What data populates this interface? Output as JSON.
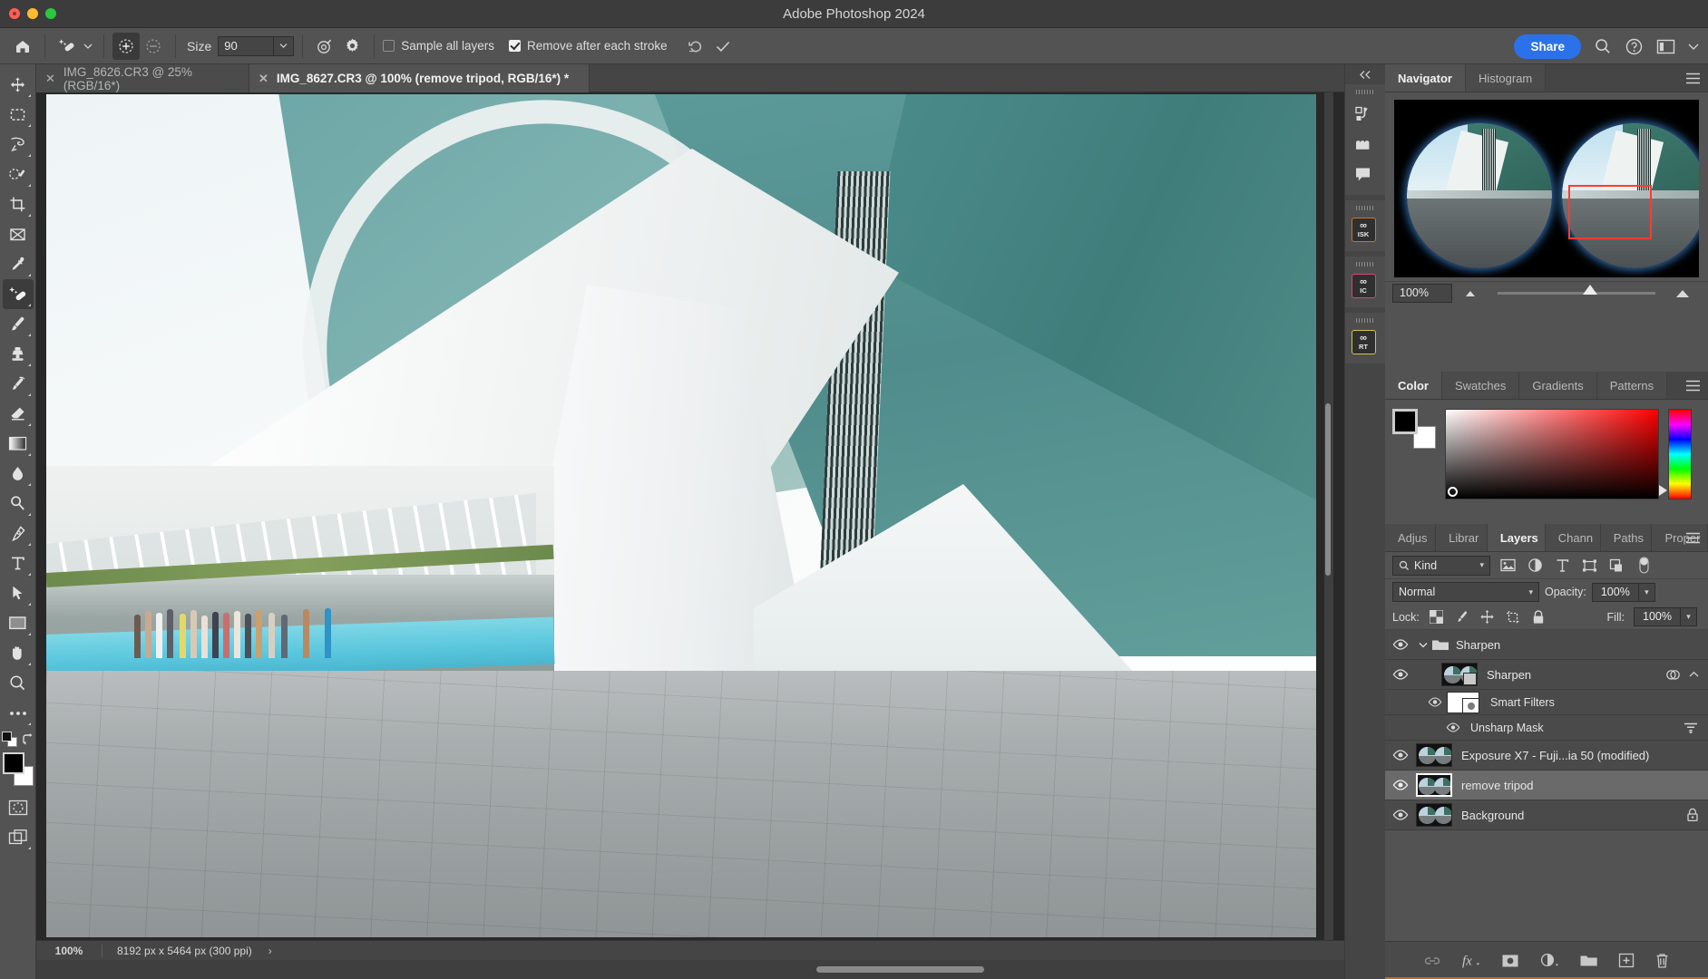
{
  "window": {
    "title": "Adobe Photoshop 2024",
    "traffic_lights": [
      "close",
      "minimize",
      "maximize"
    ]
  },
  "options_bar": {
    "home_icon": "home-icon",
    "tool_icon": "spot-healing-brush-icon",
    "tool_caret": "chevron-down-icon",
    "mode_add_icon": "add-mode-icon",
    "mode_subtract_icon": "subtract-mode-icon",
    "size_label": "Size",
    "size_value": "90",
    "size_caret": "chevron-down-icon",
    "target_icon": "brush-settings-icon",
    "gear_icon": "gear-icon",
    "sample_all_layers": {
      "label": "Sample all layers",
      "checked": false
    },
    "remove_after_each_stroke": {
      "label": "Remove after each stroke",
      "checked": true
    },
    "reset_icon": "reset-undo-icon",
    "commit_icon": "checkmark-icon",
    "share_label": "Share",
    "search_icon": "search-icon",
    "help_icon": "help-circle-icon",
    "workspace_icon": "workspace-panel-icon",
    "workspace_caret": "chevron-down-icon"
  },
  "toolbar": {
    "tools": [
      {
        "name": "move-tool",
        "icon": "move-icon",
        "active": false,
        "has_flyout": true
      },
      {
        "name": "rectangular-marquee-tool",
        "icon": "marquee-icon",
        "active": false,
        "has_flyout": true
      },
      {
        "name": "lasso-tool",
        "icon": "lasso-icon",
        "active": false,
        "has_flyout": true
      },
      {
        "name": "object-selection-tool",
        "icon": "quick-selection-icon",
        "active": false,
        "has_flyout": true
      },
      {
        "name": "crop-tool",
        "icon": "crop-icon",
        "active": false,
        "has_flyout": true
      },
      {
        "name": "frame-tool",
        "icon": "frame-icon",
        "active": false,
        "has_flyout": false
      },
      {
        "name": "eyedropper-tool",
        "icon": "eyedropper-icon",
        "active": false,
        "has_flyout": true
      },
      {
        "name": "spot-healing-brush-tool",
        "icon": "spot-healing-brush-icon",
        "active": true,
        "has_flyout": true
      },
      {
        "name": "brush-tool",
        "icon": "brush-icon",
        "active": false,
        "has_flyout": true
      },
      {
        "name": "clone-stamp-tool",
        "icon": "clone-stamp-icon",
        "active": false,
        "has_flyout": true
      },
      {
        "name": "history-brush-tool",
        "icon": "history-brush-icon",
        "active": false,
        "has_flyout": true
      },
      {
        "name": "eraser-tool",
        "icon": "eraser-icon",
        "active": false,
        "has_flyout": true
      },
      {
        "name": "gradient-tool",
        "icon": "gradient-icon",
        "active": false,
        "has_flyout": true
      },
      {
        "name": "blur-tool",
        "icon": "blur-drop-icon",
        "active": false,
        "has_flyout": true
      },
      {
        "name": "dodge-tool",
        "icon": "dodge-icon",
        "active": false,
        "has_flyout": true
      },
      {
        "name": "pen-tool",
        "icon": "pen-icon",
        "active": false,
        "has_flyout": true
      },
      {
        "name": "type-tool",
        "icon": "type-t-icon",
        "active": false,
        "has_flyout": true
      },
      {
        "name": "path-selection-tool",
        "icon": "path-arrow-icon",
        "active": false,
        "has_flyout": true
      },
      {
        "name": "rectangle-tool",
        "icon": "rectangle-shape-icon",
        "active": false,
        "has_flyout": true
      },
      {
        "name": "hand-tool",
        "icon": "hand-icon",
        "active": false,
        "has_flyout": true
      },
      {
        "name": "zoom-tool",
        "icon": "magnifier-icon",
        "active": false,
        "has_flyout": false
      },
      {
        "name": "edit-toolbar",
        "icon": "ellipsis-icon",
        "active": false,
        "has_flyout": true
      }
    ],
    "default-colors-icon": "default-foreground-background-icon",
    "swap-colors-icon": "swap-colors-icon",
    "foreground_color": "#000000",
    "background_color": "#ffffff",
    "quick_mask_icon": "quick-mask-icon",
    "screen_mode_icon": "screen-mode-icon"
  },
  "document_tabs": [
    {
      "close_icon": "close-x-icon",
      "label": "IMG_8626.CR3 @ 25% (RGB/16*)",
      "active": false
    },
    {
      "close_icon": "close-x-icon",
      "label": "IMG_8627.CR3 @ 100% (remove tripod, RGB/16*) *",
      "active": true
    }
  ],
  "status_bar": {
    "zoom": "100%",
    "dimensions": "8192 px x 5464 px (300 ppi)",
    "expand_icon": "chevron-right-icon"
  },
  "icon_dock": {
    "collapse_icon": "double-chevron-left-icon",
    "groups": [
      {
        "items": [
          {
            "name": "actions-panel-icon",
            "label": ""
          },
          {
            "name": "libraries-panel-icon",
            "label": ""
          },
          {
            "name": "comments-panel-icon",
            "label": ""
          }
        ]
      },
      {
        "items": [
          {
            "name": "plugin-isk-icon",
            "label": "ISK",
            "glyph": "∞",
            "border": "#c07a30"
          }
        ]
      },
      {
        "items": [
          {
            "name": "plugin-ic-icon",
            "label": "IC",
            "glyph": "∞",
            "border": "#d04a7a"
          }
        ]
      },
      {
        "items": [
          {
            "name": "plugin-rt-icon",
            "label": "RT",
            "glyph": "∞",
            "border": "#d4c24a"
          }
        ]
      }
    ]
  },
  "navigator_panel": {
    "tabs": [
      {
        "label": "Navigator",
        "active": true
      },
      {
        "label": "Histogram",
        "active": false
      }
    ],
    "menu_icon": "panel-menu-icon",
    "zoom_value": "100%",
    "zoom_out_icon": "small-mountain-icon",
    "zoom_in_icon": "large-mountain-icon",
    "slider_icon": "zoom-slider-handle",
    "view_box_color": "#ff3b30"
  },
  "color_panel": {
    "tabs": [
      {
        "label": "Color",
        "active": true
      },
      {
        "label": "Swatches",
        "active": false
      },
      {
        "label": "Gradients",
        "active": false
      },
      {
        "label": "Patterns",
        "active": false
      }
    ],
    "menu_icon": "panel-menu-icon",
    "foreground_color": "#000000",
    "background_color": "#ffffff",
    "ramp_base_hue": "#ff0000"
  },
  "layers_panel": {
    "tabs": [
      {
        "label": "Adjus",
        "active": false
      },
      {
        "label": "Librar",
        "active": false
      },
      {
        "label": "Layers",
        "active": true
      },
      {
        "label": "Chann",
        "active": false
      },
      {
        "label": "Paths",
        "active": false
      },
      {
        "label": "Proper",
        "active": false
      }
    ],
    "menu_icon": "panel-menu-icon",
    "filter": {
      "kind_icon": "search-icon",
      "kind_label": "Kind",
      "kind_caret": "chevron-down-icon",
      "filters": [
        "filter-pixel-icon",
        "filter-adjustment-icon",
        "filter-type-icon",
        "filter-shape-icon",
        "filter-smart-object-icon",
        "filter-toggle-icon"
      ]
    },
    "blend_mode": "Normal",
    "blend_caret": "chevron-down-icon",
    "opacity_label": "Opacity:",
    "opacity_value": "100%",
    "opacity_caret": "chevron-down-icon",
    "lock_label": "Lock:",
    "lock_icons": [
      "lock-transparent-pixels-icon",
      "lock-image-pixels-icon",
      "lock-position-icon",
      "lock-artboard-nesting-icon",
      "lock-all-icon"
    ],
    "fill_label": "Fill:",
    "fill_value": "100%",
    "fill_caret": "chevron-down-icon",
    "layers": [
      {
        "type": "group",
        "name": "Sharpen",
        "visible": true,
        "eye_icon": "eye-icon",
        "expand_icon": "chevron-down-icon",
        "folder_icon": "folder-icon",
        "selected": false
      },
      {
        "type": "smart-object",
        "name": "Sharpen",
        "visible": true,
        "eye_icon": "eye-icon",
        "indent": 1,
        "right_icons": [
          "smart-filter-badge-icon",
          "chevron-up-icon"
        ],
        "selected": false
      },
      {
        "type": "smart-filters-header",
        "name": "Smart Filters",
        "visible": true,
        "eye_icon": "eye-icon",
        "indent": 2,
        "selected": false
      },
      {
        "type": "smart-filter",
        "name": "Unsharp Mask",
        "visible": true,
        "eye_icon": "eye-icon",
        "indent": 3,
        "right_icons": [
          "filter-options-icon"
        ],
        "selected": false
      },
      {
        "type": "smart-object",
        "name": "Exposure X7 - Fuji...ia  50 (modified)",
        "visible": true,
        "eye_icon": "eye-icon",
        "selected": false
      },
      {
        "type": "pixel",
        "name": "remove tripod",
        "visible": true,
        "eye_icon": "eye-icon",
        "selected": true
      },
      {
        "type": "background",
        "name": "Background",
        "visible": true,
        "eye_icon": "eye-icon",
        "right_icons": [
          "lock-icon"
        ],
        "selected": false
      }
    ],
    "footer_icons": [
      "link-layers-icon",
      "layer-style-fx-icon",
      "add-layer-mask-icon",
      "new-adjustment-layer-icon",
      "new-group-icon",
      "new-layer-icon",
      "delete-layer-icon"
    ]
  },
  "canvas": {
    "scrollbar_h": "horizontal-scrollbar",
    "scrollbar_v": "vertical-scrollbar",
    "image_description": "architectural-photograph"
  }
}
